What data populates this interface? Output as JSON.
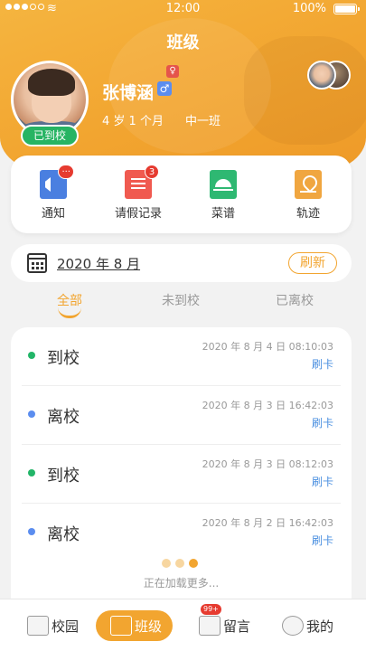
{
  "status_bar": {
    "time": "12:00",
    "battery": "100%"
  },
  "header": {
    "title": "班级",
    "child": {
      "name": "张博涵",
      "gender_symbol": "♂",
      "age": "4 岁 1 个月",
      "class": "中一班",
      "status": "已到校"
    }
  },
  "quick_menu": [
    {
      "label": "通知",
      "icon": "megaphone-icon",
      "badge": "···"
    },
    {
      "label": "请假记录",
      "icon": "document-icon",
      "badge": "3"
    },
    {
      "label": "菜谱",
      "icon": "food-cover-icon",
      "badge": ""
    },
    {
      "label": "轨迹",
      "icon": "location-icon",
      "badge": ""
    }
  ],
  "date_filter": {
    "date": "2020 年 8 月",
    "refresh_label": "刷新"
  },
  "tabs": [
    "全部",
    "未到校",
    "已离校"
  ],
  "records": [
    {
      "type": "到校",
      "datetime": "2020 年 8 月 4 日  08:10:03",
      "method": "刷卡",
      "color": "#22b568"
    },
    {
      "type": "离校",
      "datetime": "2020 年 8 月 3 日  16:42:03",
      "method": "刷卡",
      "color": "#5b8def"
    },
    {
      "type": "到校",
      "datetime": "2020 年 8 月 3 日  08:12:03",
      "method": "刷卡",
      "color": "#22b568"
    },
    {
      "type": "离校",
      "datetime": "2020 年 8 月 2 日  16:42:03",
      "method": "刷卡",
      "color": "#5b8def"
    }
  ],
  "loading_text": "正在加载更多...",
  "bottom_nav": [
    {
      "label": "校园",
      "icon": "campus-icon"
    },
    {
      "label": "班级",
      "icon": "class-icon"
    },
    {
      "label": "留言",
      "icon": "message-icon",
      "badge": "99+"
    },
    {
      "label": "我的",
      "icon": "profile-icon"
    }
  ],
  "colors": {
    "accent": "#f2a530",
    "arrived": "#22b568",
    "left": "#5b8def"
  }
}
